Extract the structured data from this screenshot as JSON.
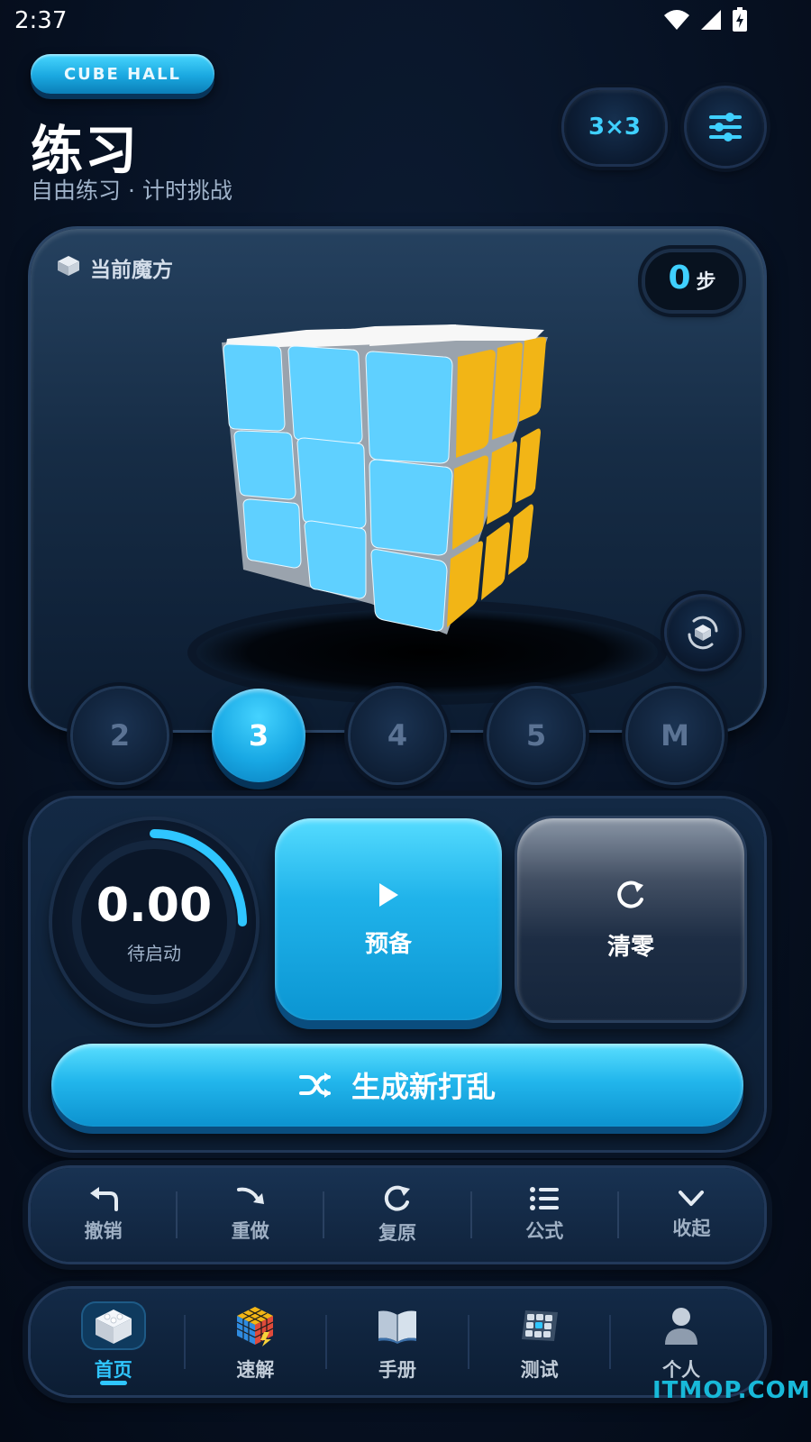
{
  "status_bar": {
    "time": "2:37"
  },
  "header": {
    "brand": "CUBE HALL",
    "title": "练习",
    "subtitle": "自由练习 · 计时挑战",
    "cube_size": "3×3"
  },
  "cube_card": {
    "label": "当前魔方",
    "steps_value": "0",
    "steps_unit": "步"
  },
  "orders": [
    {
      "label": "2",
      "active": false
    },
    {
      "label": "3",
      "active": true
    },
    {
      "label": "4",
      "active": false
    },
    {
      "label": "5",
      "active": false
    },
    {
      "label": "M",
      "active": false
    }
  ],
  "timer": {
    "value": "0.00",
    "status": "待启动",
    "ring_progress": 0.25,
    "accent": "#2fc6ff"
  },
  "buttons": {
    "ready": "预备",
    "reset": "清零",
    "scramble": "生成新打乱"
  },
  "actions": [
    {
      "label": "撤销",
      "icon": "undo-icon"
    },
    {
      "label": "重做",
      "icon": "redo-icon"
    },
    {
      "label": "复原",
      "icon": "restore-icon"
    },
    {
      "label": "公式",
      "icon": "list-icon"
    },
    {
      "label": "收起",
      "icon": "chevron-down-icon"
    }
  ],
  "nav": [
    {
      "label": "首页",
      "icon": "cube-home-icon",
      "active": true
    },
    {
      "label": "速解",
      "icon": "rubiks-cube-icon",
      "active": false
    },
    {
      "label": "手册",
      "icon": "book-icon",
      "active": false
    },
    {
      "label": "测试",
      "icon": "grid-icon",
      "active": false
    },
    {
      "label": "个人",
      "icon": "user-icon",
      "active": false
    }
  ],
  "cube_colors": {
    "front": "#5fd0ff",
    "right": "#f2b516",
    "top": "#f7f7f7"
  },
  "watermark": "ITMOP.COM"
}
